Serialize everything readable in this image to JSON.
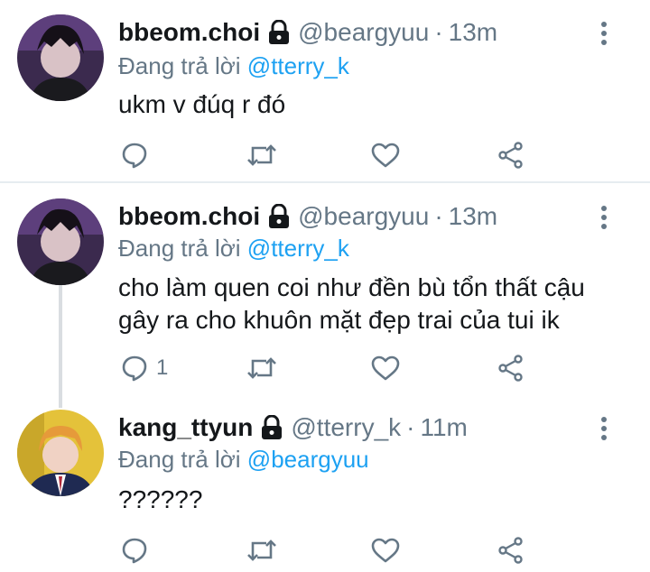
{
  "tweets": [
    {
      "name": "bbeom.choi",
      "handle": "@beargyuu",
      "separator": "·",
      "time": "13m",
      "replying_prefix": "Đang trả lời",
      "replying_to": "@tterry_k",
      "text": "ukm v đúq r đó",
      "reply_count": ""
    },
    {
      "name": "bbeom.choi",
      "handle": "@beargyuu",
      "separator": "·",
      "time": "13m",
      "replying_prefix": "Đang trả lời",
      "replying_to": "@tterry_k",
      "text": "cho làm quen coi như đền bù tổn thất cậu gây ra cho khuôn mặt đẹp trai của tui ik",
      "reply_count": "1"
    },
    {
      "name": "kang_ttyun",
      "handle": "@tterry_k",
      "separator": "·",
      "time": "11m",
      "replying_prefix": "Đang trả lời",
      "replying_to": "@beargyuu",
      "text": "??????",
      "reply_count": ""
    }
  ],
  "icons": {
    "lock": "lock-icon",
    "more": "more-vertical-icon",
    "reply": "reply-icon",
    "retweet": "retweet-icon",
    "like": "heart-icon",
    "share": "share-icon"
  },
  "colors": {
    "text": "#14171a",
    "muted": "#657786",
    "accent": "#1da1f2",
    "divider": "#e6ecf0"
  }
}
